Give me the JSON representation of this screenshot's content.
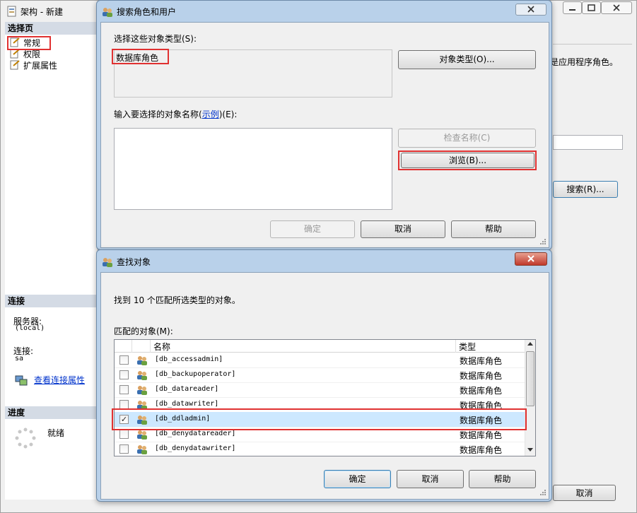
{
  "main_window": {
    "title": "架构 - 新建",
    "select_page_header": "选择页",
    "pages": [
      {
        "label": "常规"
      },
      {
        "label": "权限"
      },
      {
        "label": "扩展属性"
      }
    ],
    "connection_header": "连接",
    "server_label": "服务器:",
    "server_value": "(local)",
    "connection_label": "连接:",
    "connection_value": "sa",
    "view_conn_link": "查看连接属性",
    "progress_header": "进度",
    "progress_status": "就绪",
    "right_text_fragment": "是应用程序角色。",
    "search_button": "搜索(R)...",
    "cancel_button": "取消"
  },
  "search_dialog": {
    "title": "搜索角色和用户",
    "object_types_label": "选择这些对象类型(S):",
    "object_types_value": "数据库角色",
    "object_types_button": "对象类型(O)...",
    "enter_names_label_pre": "输入要选择的对象名称(",
    "enter_names_link": "示例",
    "enter_names_label_post": ")(E):",
    "names_value": "",
    "check_names_button": "检查名称(C)",
    "browse_button": "浏览(B)...",
    "ok_button": "确定",
    "cancel_button": "取消",
    "help_button": "帮助"
  },
  "find_dialog": {
    "title": "查找对象",
    "found_text": "找到 10 个匹配所选类型的对象。",
    "matching_label": "匹配的对象(M):",
    "columns": {
      "name": "名称",
      "type": "类型"
    },
    "rows": [
      {
        "name": "[db_accessadmin]",
        "type": "数据库角色",
        "checked": false
      },
      {
        "name": "[db_backupoperator]",
        "type": "数据库角色",
        "checked": false
      },
      {
        "name": "[db_datareader]",
        "type": "数据库角色",
        "checked": false
      },
      {
        "name": "[db_datawriter]",
        "type": "数据库角色",
        "checked": false
      },
      {
        "name": "[db_ddladmin]",
        "type": "数据库角色",
        "checked": true
      },
      {
        "name": "[db_denydatareader]",
        "type": "数据库角色",
        "checked": false
      },
      {
        "name": "[db_denydatawriter]",
        "type": "数据库角色",
        "checked": false
      }
    ],
    "ok_button": "确定",
    "cancel_button": "取消",
    "help_button": "帮助"
  },
  "colors": {
    "highlight_red": "#e03131",
    "selected_row": "#cde8ff",
    "titlebar": "#b9d1ea",
    "section_header": "#d4dbe5",
    "link": "#0033cc"
  },
  "icons": [
    "window-icon",
    "page-icon",
    "users-icon",
    "connection-icon",
    "progress-spinner-icon",
    "close-icon",
    "minimize-icon",
    "maximize-icon",
    "role-icon",
    "resize-grip-icon"
  ]
}
